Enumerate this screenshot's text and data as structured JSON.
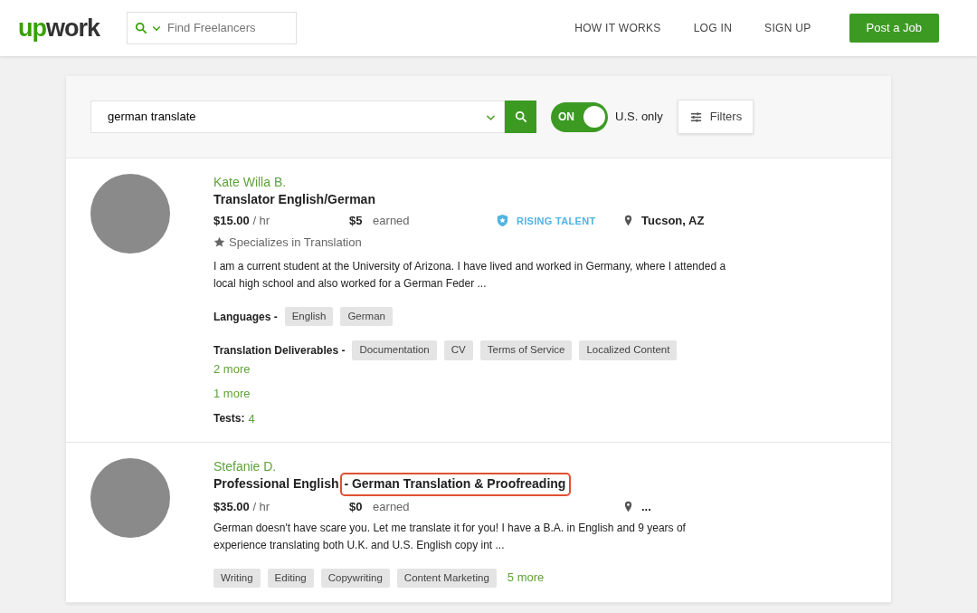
{
  "header": {
    "logo": "upwork",
    "search_placeholder": "Find Freelancers",
    "nav": [
      "HOW IT WORKS",
      "LOG IN",
      "SIGN UP"
    ],
    "cta": "Post a Job"
  },
  "search": {
    "value": "german translate",
    "toggle": {
      "label": "ON",
      "on": true
    },
    "toggle_caption": "U.S. only",
    "filters": "Filters"
  },
  "freelancers": [
    {
      "name": "Kate Willa B.",
      "title_parts": [
        {
          "text": "Translator English/German",
          "highlighted": false
        }
      ],
      "rate": "$15.00",
      "rate_unit": "/ hr",
      "earned": "$5",
      "earned_label": "earned",
      "badge": "RISING TALENT",
      "location": "Tucson, AZ",
      "specialty": "Specializes in Translation",
      "description": "I am a current student at the University of Arizona. I have lived and worked in Germany, where I attended a local high school and also worked for a German Feder ...",
      "sections": [
        {
          "kind": "group",
          "label": "Languages -",
          "tags": [
            "English",
            "German"
          ]
        },
        {
          "kind": "group",
          "label": "Translation Deliverables -",
          "tags": [
            "Documentation",
            "CV",
            "Terms of Service",
            "Localized Content"
          ],
          "more": "2 more"
        },
        {
          "kind": "more",
          "text": "1 more"
        },
        {
          "kind": "tests",
          "label": "Tests:",
          "value": "4"
        }
      ]
    },
    {
      "name": "Stefanie D.",
      "title_parts": [
        {
          "text": "Professional English ",
          "highlighted": false
        },
        {
          "text": "- German Translation & Proofreading",
          "highlighted": true
        }
      ],
      "rate": "$35.00",
      "rate_unit": "/ hr",
      "earned": "$0",
      "earned_label": "earned",
      "location": "...",
      "description": "German doesn't have scare you. Let me translate it for you! I have a B.A. in English and 9 years of experience translating both U.K. and U.S. English copy int ...",
      "sections": [
        {
          "kind": "tags",
          "tags": [
            "Writing",
            "Editing",
            "Copywriting",
            "Content Marketing"
          ],
          "more": "5 more"
        }
      ]
    }
  ]
}
